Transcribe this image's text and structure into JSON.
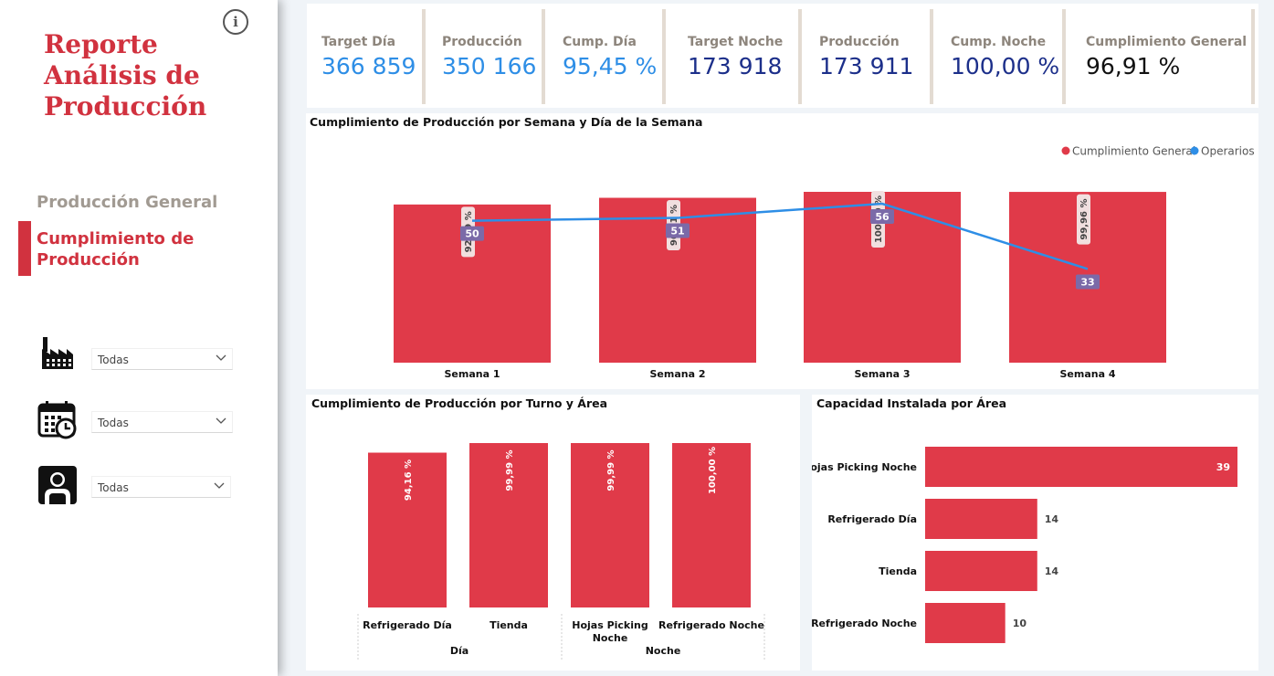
{
  "sidebar": {
    "title_lines": [
      "Reporte",
      "Análisis de",
      "Producción"
    ],
    "info_icon": "i",
    "nav": {
      "general": "Producción General",
      "cumplimiento_lines": [
        "Cumplimiento de",
        "Producción"
      ]
    },
    "slicers": [
      {
        "icon": "factory-icon",
        "value": "Todas"
      },
      {
        "icon": "calendar-clock-icon",
        "value": "Todas"
      },
      {
        "icon": "person-icon",
        "value": "Todas"
      }
    ]
  },
  "kpis": [
    {
      "label": "Target Día",
      "value": "366 859",
      "color": "#2e8ee6"
    },
    {
      "label": "Producción",
      "value": "350 166",
      "color": "#2e8ee6"
    },
    {
      "label": "Cump. Día",
      "value": "95,45 %",
      "color": "#2e8ee6"
    },
    {
      "label": "Target Noche",
      "value": "173 918",
      "color": "#1c2f8a"
    },
    {
      "label": "Producción",
      "value": "173 911",
      "color": "#1c2f8a"
    },
    {
      "label": "Cump. Noche",
      "value": "100,00 %",
      "color": "#1c2f8a"
    },
    {
      "label": "Cumplimiento General",
      "value": "96,91 %",
      "color": "#111111"
    }
  ],
  "colors": {
    "bar": "#e03a49",
    "line": "#2e8ee6",
    "accent": "#d1323f",
    "line_label_bg": "#7b6aa8"
  },
  "chart_data": [
    {
      "type": "bar",
      "title": "Cumplimiento de Producción por Semana y Día de la Semana",
      "categories": [
        "Semana 1",
        "Semana 2",
        "Semana 3",
        "Semana 4"
      ],
      "series": [
        {
          "name": "Cumplimiento General",
          "values": [
            92.59,
            96.51,
            100.0,
            99.96
          ],
          "labels": [
            "92,59 %",
            "96,51 %",
            "100,00 %",
            "99,96 %"
          ],
          "color": "#e03a49",
          "kind": "bar"
        },
        {
          "name": "Operarios",
          "values": [
            50,
            51,
            56,
            33
          ],
          "labels": [
            "50",
            "51",
            "56",
            "33"
          ],
          "color": "#2e8ee6",
          "kind": "line"
        }
      ],
      "legend": "top-right"
    },
    {
      "type": "bar",
      "title": "Cumplimiento de Producción por Turno y Área",
      "categories": [
        "Refrigerado Día",
        "Tienda",
        "Hojas Picking Noche",
        "Refrigerado Noche"
      ],
      "category_lines": [
        [
          "Refrigerado Día"
        ],
        [
          "Tienda"
        ],
        [
          "Hojas Picking",
          "Noche"
        ],
        [
          "Refrigerado Noche"
        ]
      ],
      "groups": [
        "Día",
        "Noche"
      ],
      "values": [
        94.16,
        99.99,
        99.99,
        100.0
      ],
      "labels": [
        "94,16 %",
        "99,99 %",
        "99,99 %",
        "100,00 %"
      ]
    },
    {
      "type": "bar",
      "orientation": "horizontal",
      "title": "Capacidad Instalada por Área",
      "categories": [
        "Hojas Picking Noche",
        "Refrigerado Día",
        "Tienda",
        "Refrigerado Noche"
      ],
      "values": [
        39,
        14,
        14,
        10
      ],
      "labels": [
        "39",
        "14",
        "14",
        "10"
      ]
    }
  ]
}
